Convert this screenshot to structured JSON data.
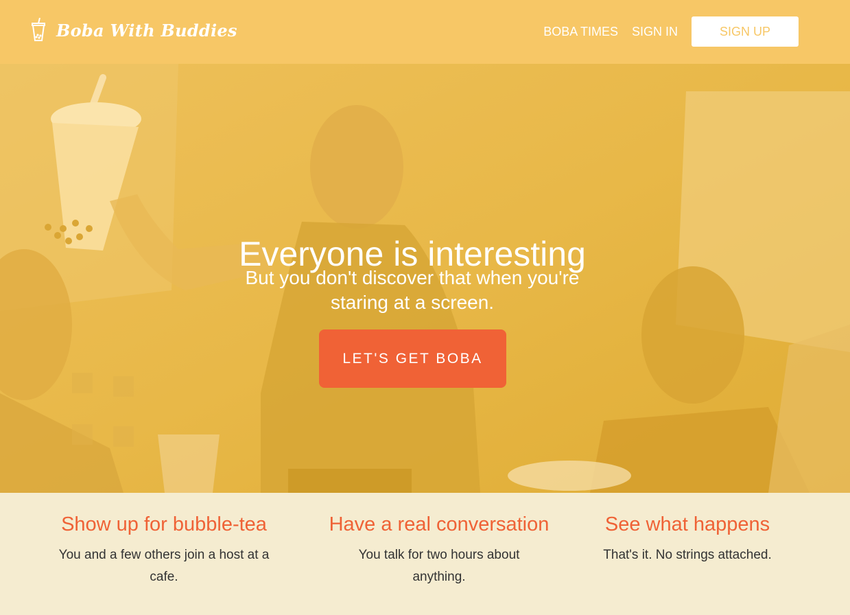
{
  "brand": {
    "name": "Boba With Buddies",
    "logo_icon": "boba-cup-icon"
  },
  "nav": {
    "links": [
      "BOBA TIMES",
      "SIGN IN"
    ],
    "signup_label": "SIGN UP"
  },
  "hero": {
    "title": "Everyone is interesting",
    "subtitle": "But you don't discover that when you're staring at a screen.",
    "cta_label": "LET'S GET BOBA"
  },
  "features": [
    {
      "title": "Show up for bubble-tea",
      "text": "You and a few others join a host at a cafe."
    },
    {
      "title": "Have a real conversation",
      "text": "You talk for two hours about anything."
    },
    {
      "title": "See what happens",
      "text": "That's it. No strings attached."
    }
  ],
  "colors": {
    "header_bg": "#f7c766",
    "hero_overlay": "#e5b53e",
    "accent": "#f06236",
    "features_bg": "#f5ecd0"
  }
}
